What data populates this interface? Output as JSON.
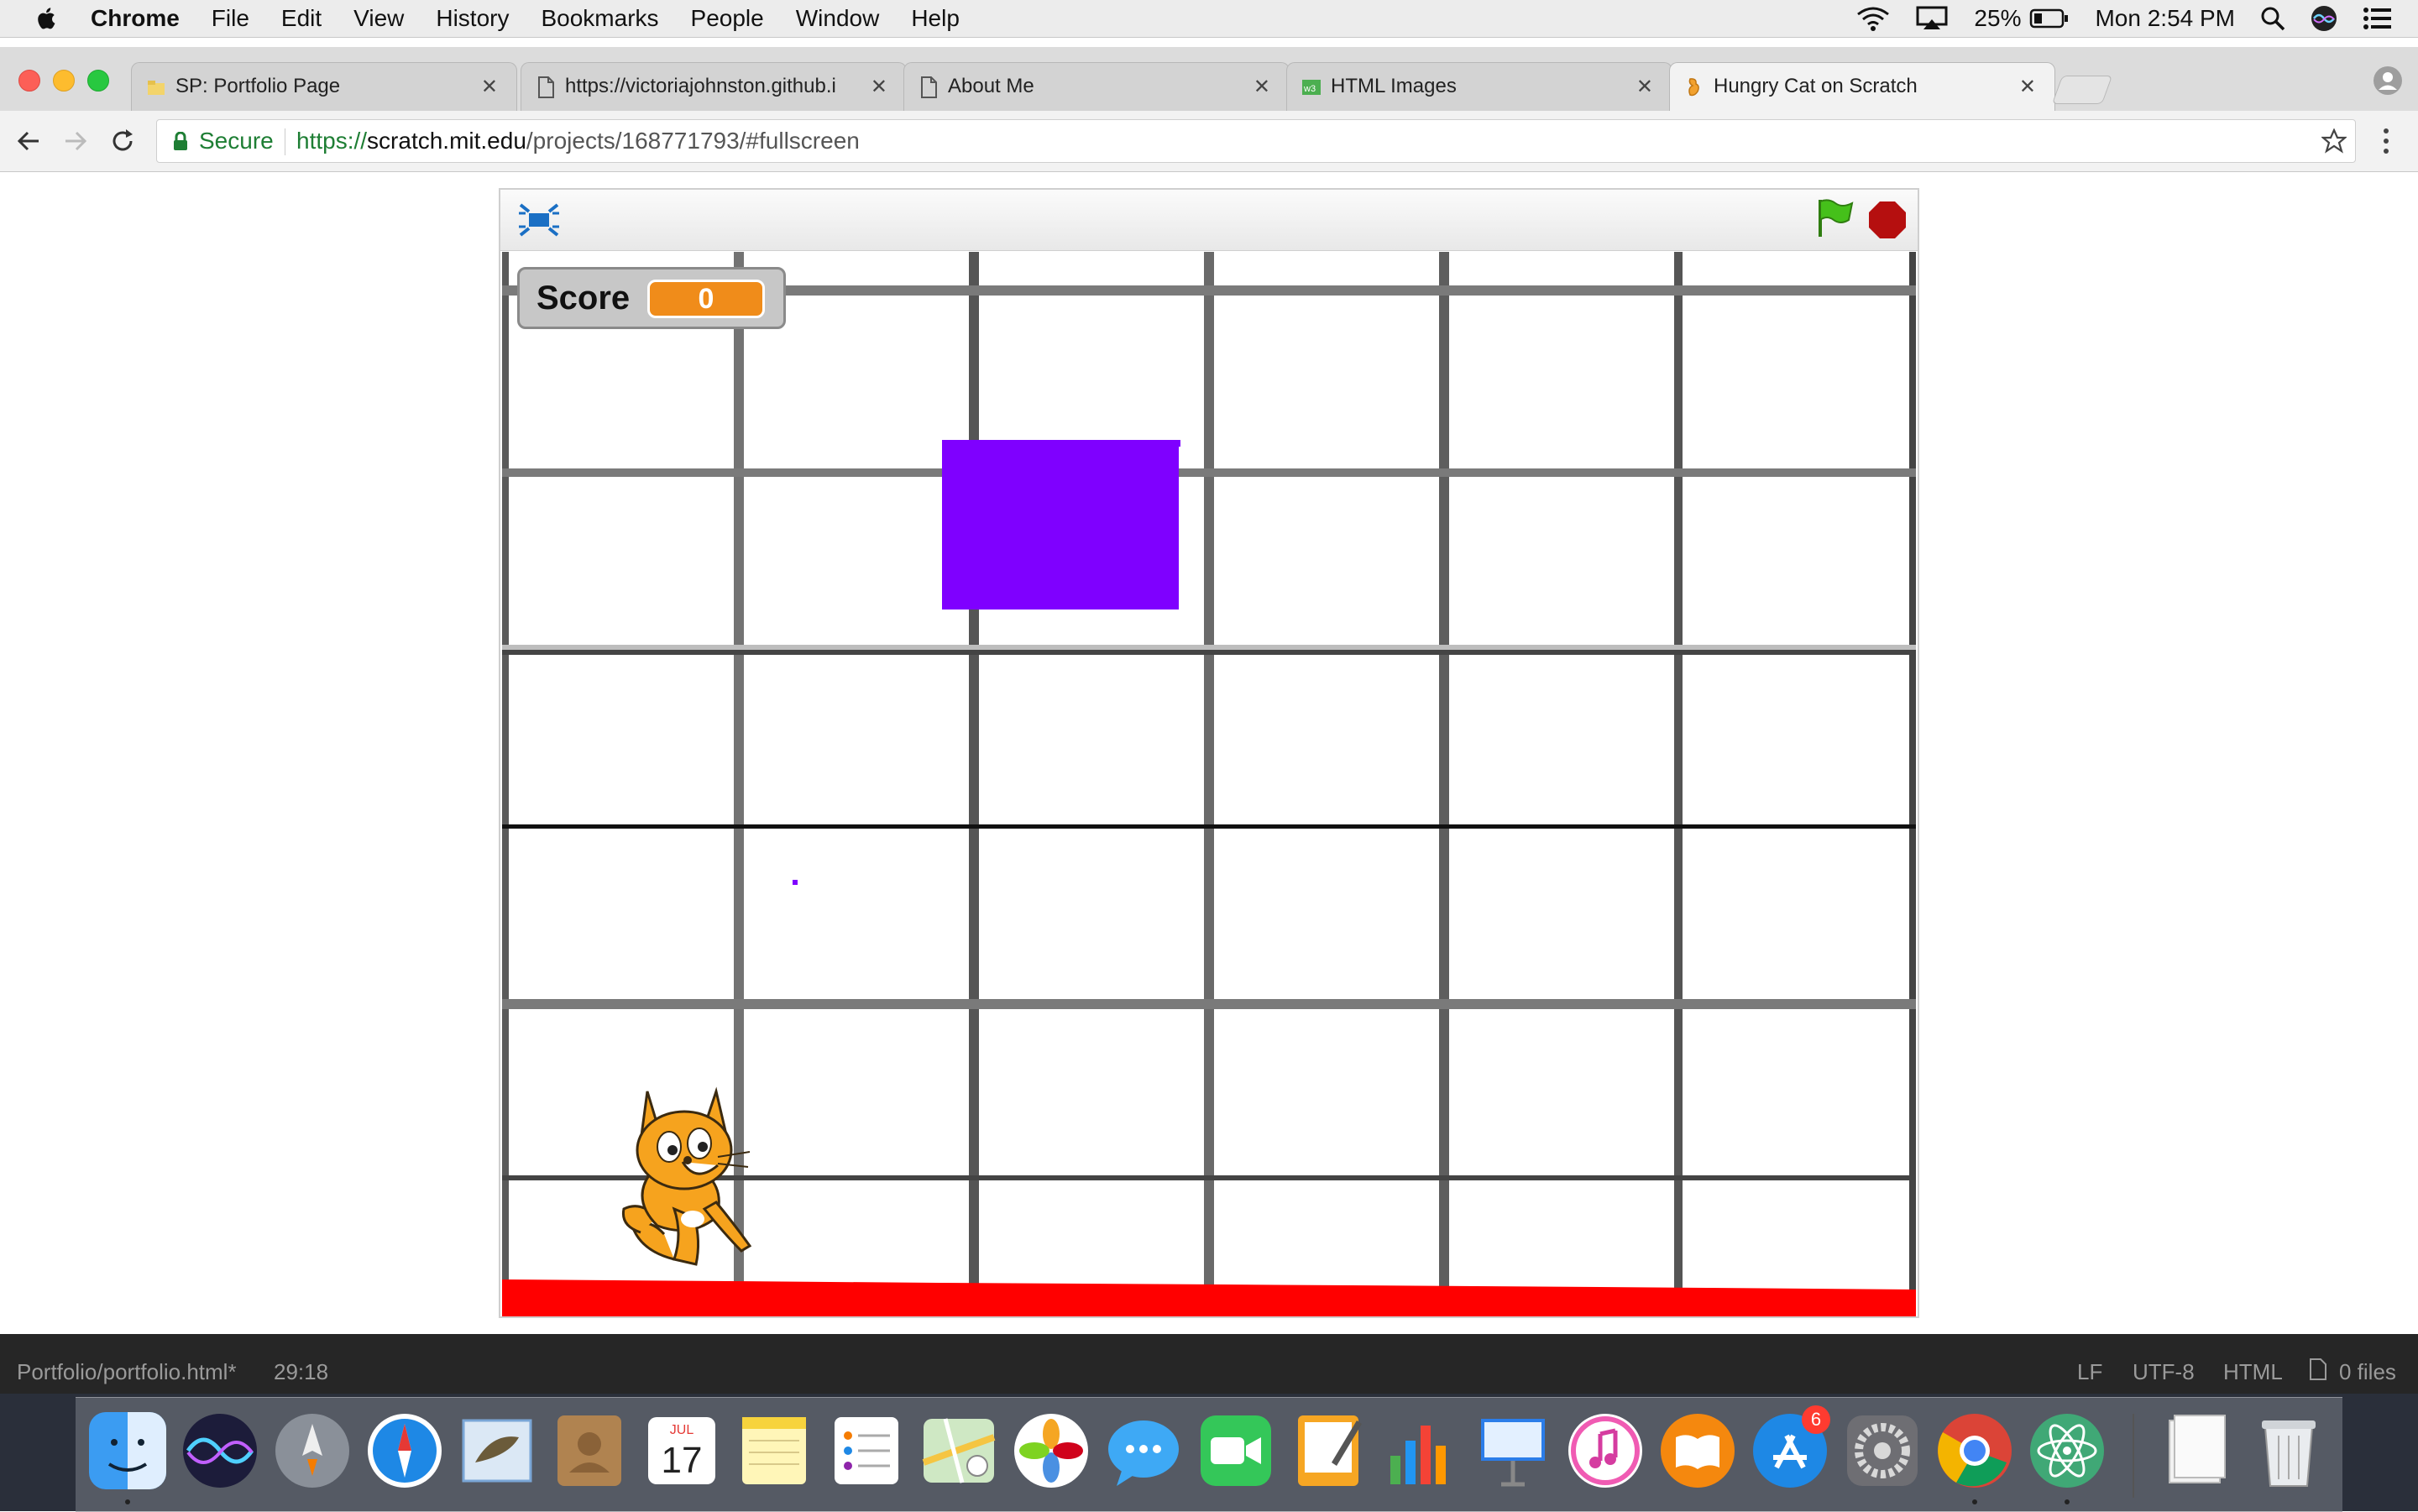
{
  "menubar": {
    "app": "Chrome",
    "items": [
      "File",
      "Edit",
      "View",
      "History",
      "Bookmarks",
      "People",
      "Window",
      "Help"
    ],
    "battery": "25%",
    "clock": "Mon 2:54 PM"
  },
  "tabs": [
    {
      "title": "SP: Portfolio Page"
    },
    {
      "title": "https://victoriajohnston.github.i"
    },
    {
      "title": "About Me"
    },
    {
      "title": "HTML Images"
    },
    {
      "title": "Hungry Cat on Scratch",
      "active": true
    }
  ],
  "address_bar": {
    "secure_label": "Secure",
    "url_scheme": "https://",
    "url_host": "scratch.mit.edu",
    "url_path": "/projects/168771793/#fullscreen"
  },
  "scratch": {
    "score_label": "Score",
    "score_value": "0",
    "colors": {
      "falling_block": "#7f00ff",
      "floor": "#ff0000",
      "monitor_value": "#f08c1a",
      "flag": "#45c01a",
      "stop": "#b50f0f"
    }
  },
  "status_bar": {
    "file": "Portfolio/portfolio.html*",
    "cursor": "29:18",
    "line_ending": "LF",
    "encoding": "UTF-8",
    "grammar": "HTML",
    "files": "0 files"
  },
  "dock": {
    "calendar_month": "JUL",
    "calendar_day": "17",
    "app_store_badge": "6",
    "icons": [
      "finder-icon",
      "siri-icon",
      "launchpad-icon",
      "safari-icon",
      "mail-icon",
      "contacts-icon",
      "calendar-icon",
      "notes-icon",
      "reminders-icon",
      "maps-icon",
      "photos-icon",
      "messages-icon",
      "facetime-icon",
      "pages-icon",
      "numbers-icon",
      "keynote-icon",
      "itunes-icon",
      "ibooks-icon",
      "app-store-icon",
      "system-preferences-icon",
      "chrome-icon",
      "atom-icon",
      "downloads-stack-icon",
      "trash-icon"
    ]
  }
}
